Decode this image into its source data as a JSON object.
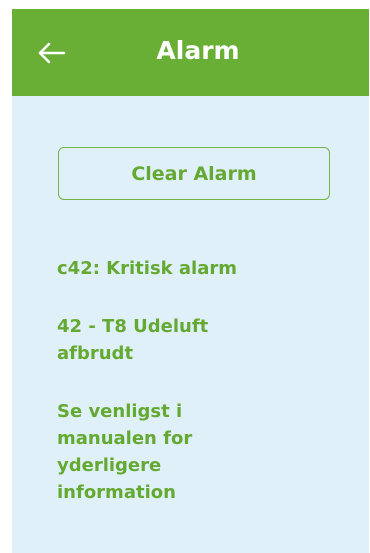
{
  "header": {
    "title": "Alarm",
    "back_icon": "arrow-left-icon"
  },
  "actions": {
    "clear_label": "Clear Alarm"
  },
  "alarm": {
    "code_line": "c42: Kritisk alarm",
    "description": "42 - T8 Udeluft afbrudt",
    "help_text": "Se venligst i manualen for yderligere information"
  },
  "colors": {
    "header_bg": "#6aaf35",
    "screen_bg": "#dff0f8",
    "accent_text": "#64a932"
  }
}
